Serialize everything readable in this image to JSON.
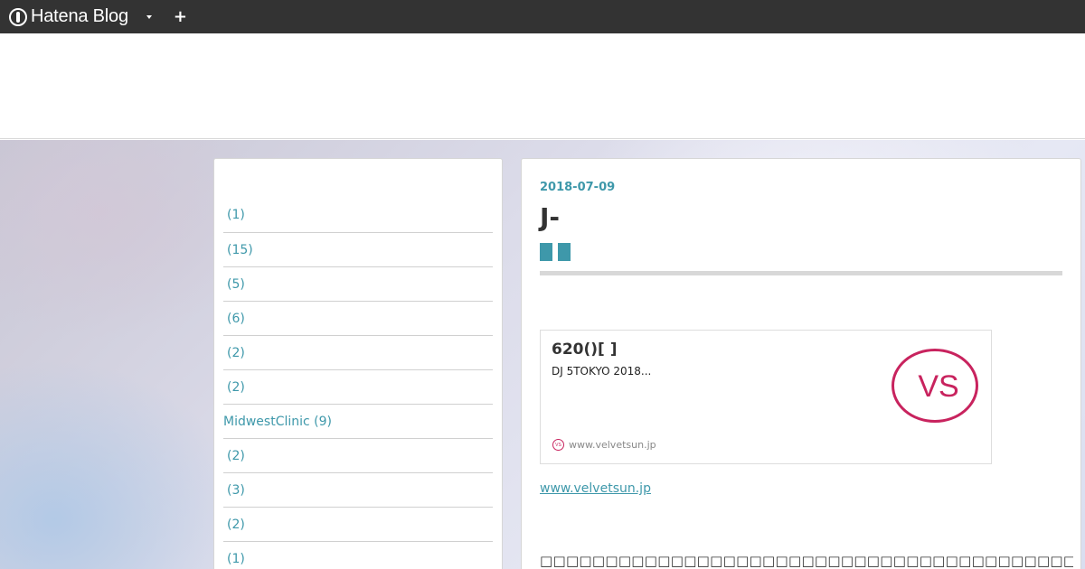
{
  "globalbar": {
    "brand": "Hatena Blog",
    "plus_label": "+"
  },
  "sidebar": {
    "categories": [
      {
        "label": "(1)"
      },
      {
        "label": "(15)"
      },
      {
        "label": "(5)"
      },
      {
        "label": "(6)"
      },
      {
        "label": "(2)"
      },
      {
        "label": "(2)"
      },
      {
        "label": "MidwestClinic (9)"
      },
      {
        "label": "(2)"
      },
      {
        "label": "(3)"
      },
      {
        "label": "(2)"
      },
      {
        "label": "(1)"
      }
    ]
  },
  "article": {
    "date": "2018-07-09",
    "title": "J-",
    "embed": {
      "title": "620()[ ]",
      "description": "DJ 5TOKYO 2018...",
      "logo_text": "VS",
      "favicon_text": "VS",
      "site": "www.velvetsun.jp"
    },
    "link_text": "www.velvetsun.jp",
    "body_text": "□□□□□□□□□□□□□□□□□□□□□□□□□□□□□□□□□□□□□□□□□□□□□□□□□□□□□□□□□□□□□□□□"
  },
  "colors": {
    "accent": "#3e98aa",
    "globalbar": "#333333",
    "logo": "#c8235e"
  }
}
